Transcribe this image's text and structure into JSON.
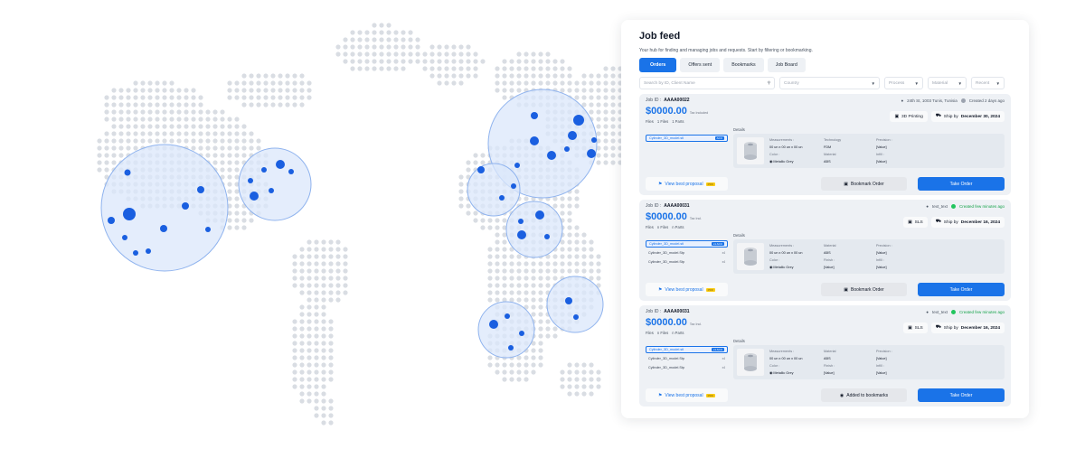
{
  "feed": {
    "title": "Job feed",
    "subtitle": "Your hub for finding and managing jobs and requests. Start by filtering or bookmarking.",
    "tabs": [
      {
        "label": "Orders",
        "active": true
      },
      {
        "label": "Offers sent",
        "active": false
      },
      {
        "label": "Bookmarks",
        "active": false
      },
      {
        "label": "Job Board",
        "active": false
      }
    ],
    "filters": {
      "search_placeholder": "Search by ID, Client Name",
      "country": "Country",
      "process": "Process",
      "material": "Material",
      "recent": "Recent"
    }
  },
  "cards": [
    {
      "job_label": "Job ID :",
      "job_id": "AAAA00022",
      "location": "24th St, 1003 Tunis, Tunisia",
      "status": "Created 2 days ago",
      "price": "$0000.00",
      "price_note": "Tax Included",
      "chip1": "3D Printing",
      "ship_label": "Ship by",
      "ship_date": "December 30, 2024",
      "files_label": "Files",
      "files_count": "1 Files",
      "parts_count": "1 Parts",
      "details_label": "Details",
      "files": [
        {
          "name": "Cylinder_3D_model.stl",
          "badge": "ACC",
          "selected": true
        }
      ],
      "details": {
        "measurements_label": "Measurements :",
        "measurements": "00 un x 00 un x 00 un",
        "color_label": "Color :",
        "color": "Metallic Grey",
        "col2_label_a": "Technology",
        "col2_val_a": "FDM",
        "col2_label_b": "Material",
        "col2_val_b": "ABS",
        "col3_label_a": "Precision :",
        "col3_val_a": "[Value]",
        "col3_label_b": "Infill :",
        "col3_val_b": "[Value]"
      },
      "proposal": "View best proposal",
      "pro": "PRO",
      "bookmark": "Bookmark Order",
      "bookmarked": false,
      "take": "Take Order"
    },
    {
      "job_label": "Job ID :",
      "job_id": "AAAA00031",
      "location": "text_text",
      "status": "Created few minutes ago",
      "price": "$0000.00",
      "price_note": "Tax Incl.",
      "chip1": "SLS",
      "ship_label": "Ship by",
      "ship_date": "December 16, 2024",
      "files_label": "Files",
      "files_count": "n Files",
      "parts_count": "n Parts",
      "details_label": "Details",
      "files": [
        {
          "name": "Cylinder_3D_model.stl",
          "badge": "x1 ACC",
          "selected": true
        },
        {
          "name": "Cylinder_3D_model.Stp",
          "badge": "x4",
          "selected": false
        },
        {
          "name": "Cylinder_3D_model.Stp",
          "badge": "x4",
          "selected": false
        }
      ],
      "details": {
        "measurements_label": "Measurements :",
        "measurements": "00 un x 00 un x 00 un",
        "color_label": "Color :",
        "color": "Metallic Grey",
        "col2_label_a": "Material",
        "col2_val_a": "ABS",
        "col2_label_b": "Finish :",
        "col2_val_b": "[Value]",
        "col3_label_a": "Precision :",
        "col3_val_a": "[Value]",
        "col3_label_b": "Infill :",
        "col3_val_b": "[Value]"
      },
      "proposal": "View best proposal",
      "pro": "PRO",
      "bookmark": "Bookmark Order",
      "bookmarked": false,
      "take": "Take Order"
    },
    {
      "job_label": "Job ID :",
      "job_id": "AAAA00031",
      "location": "text_text",
      "status": "Created few minutes ago",
      "price": "$0000.00",
      "price_note": "Tax Incl.",
      "chip1": "SLS",
      "ship_label": "Ship by",
      "ship_date": "December 16, 2024",
      "files_label": "Files",
      "files_count": "n Files",
      "parts_count": "n Parts",
      "details_label": "Details",
      "files": [
        {
          "name": "Cylinder_3D_model.stl",
          "badge": "x1 ACC",
          "selected": true
        },
        {
          "name": "Cylinder_3D_model.Stp",
          "badge": "x4",
          "selected": false
        },
        {
          "name": "Cylinder_3D_model.Stp",
          "badge": "x4",
          "selected": false
        }
      ],
      "details": {
        "measurements_label": "Measurements :",
        "measurements": "00 un x 00 un x 00 un",
        "color_label": "Color :",
        "color": "Metallic Grey",
        "col2_label_a": "Material",
        "col2_val_a": "ABS",
        "col2_label_b": "Finish :",
        "col2_val_b": "[Value]",
        "col3_label_a": "Precision :",
        "col3_val_a": "[Value]",
        "col3_label_b": "Infill :",
        "col3_val_b": "[Value]"
      },
      "proposal": "View best proposal",
      "pro": "PRO",
      "bookmark": "Added to bookmarks",
      "bookmarked": true,
      "take": "Take Order"
    }
  ],
  "colors": {
    "accent": "#1a73e8",
    "map_dots": "#d9dde3",
    "cluster_fill": "#dbe7fb",
    "cluster_stroke": "#8fb3ee",
    "marker": "#1a5fe0"
  }
}
